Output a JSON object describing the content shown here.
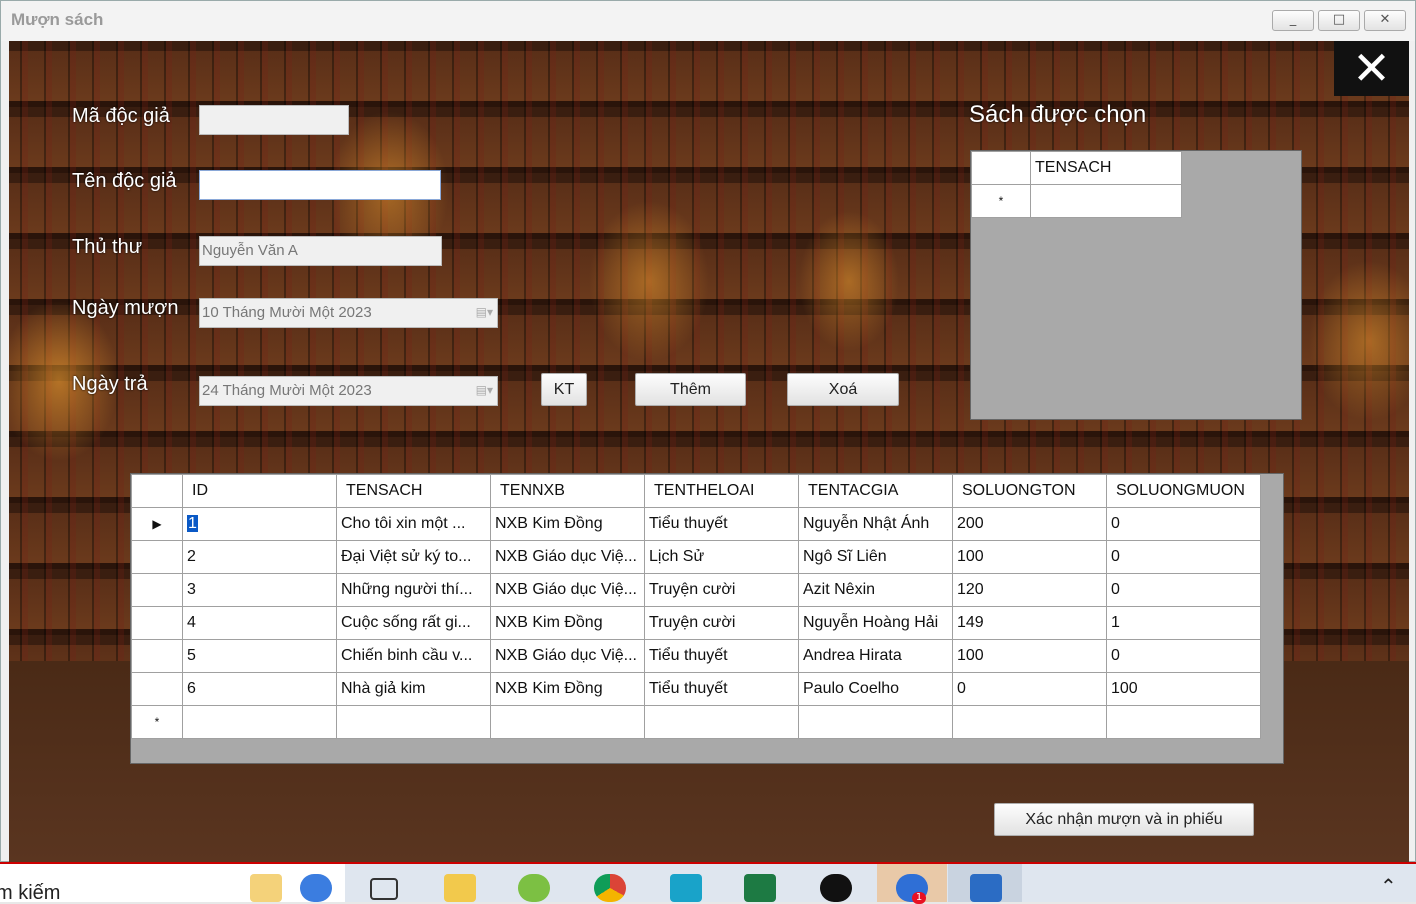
{
  "window": {
    "title": "Mượn sách",
    "minimize": "_",
    "maximize": "□",
    "close": "✕"
  },
  "close_button": "✕",
  "form": {
    "ma_doc_gia_label": "Mã độc giả",
    "ma_doc_gia_value": "",
    "ten_doc_gia_label": "Tên độc giả",
    "ten_doc_gia_value": "",
    "thu_thu_label": "Thủ thư",
    "thu_thu_value": "Nguyễn Văn A",
    "ngay_muon_label": "Ngày mượn",
    "ngay_muon_value": "10 Tháng Mười Một 2023",
    "ngay_tra_label": "Ngày trả",
    "ngay_tra_value": "24 Tháng Mười Một 2023"
  },
  "buttons": {
    "kt": "KT",
    "them": "Thêm",
    "xoa": "Xoá",
    "confirm": "Xác nhận mượn và in phiếu"
  },
  "selected_panel": {
    "title": "Sách được chọn",
    "columns": [
      "TENSACH"
    ],
    "new_row_marker": "*"
  },
  "books_grid": {
    "columns": [
      "ID",
      "TENSACH",
      "TENNXB",
      "TENTHELOAI",
      "TENTACGIA",
      "SOLUONGTON",
      "SOLUONGMUON"
    ],
    "rows": [
      [
        "1",
        "Cho tôi xin một ...",
        "NXB Kim Đồng",
        "Tiểu thuyết",
        "Nguyễn Nhật Ánh",
        "200",
        "0"
      ],
      [
        "2",
        "Đại Việt sử ký to...",
        "NXB Giáo dục Việ...",
        "Lịch Sử",
        "Ngô Sĩ Liên",
        "100",
        "0"
      ],
      [
        "3",
        "Những người thí...",
        "NXB Giáo dục Việ...",
        "Truyện cười",
        "Azit Nêxin",
        "120",
        "0"
      ],
      [
        "4",
        "Cuộc sống rất gi...",
        "NXB Kim Đồng",
        "Truyện cười",
        "Nguyễn Hoàng Hải",
        "149",
        "1"
      ],
      [
        "5",
        "Chiến binh cầu v...",
        "NXB Giáo dục Việ...",
        "Tiểu thuyết",
        "Andrea Hirata",
        "100",
        "0"
      ],
      [
        "6",
        "Nhà giả kim",
        "NXB Kim Đồng",
        "Tiểu thuyết",
        "Paulo Coelho",
        "0",
        "100"
      ]
    ],
    "current_row_marker": "▶",
    "new_row_marker": "*"
  },
  "taskbar": {
    "search_text": "m kiếm",
    "icons": [
      "news-widget-icon",
      "task-view-icon",
      "file-explorer-icon",
      "browser-icon",
      "chrome-icon",
      "app-icon",
      "excel-icon",
      "record-icon",
      "zalo-icon",
      "window-app-icon",
      "chevron-up-icon"
    ],
    "zalo_badge": "1"
  },
  "colors": {
    "selection": "#0a59c6",
    "grid_bg": "#a9a9a9",
    "badge": "#e81123"
  }
}
